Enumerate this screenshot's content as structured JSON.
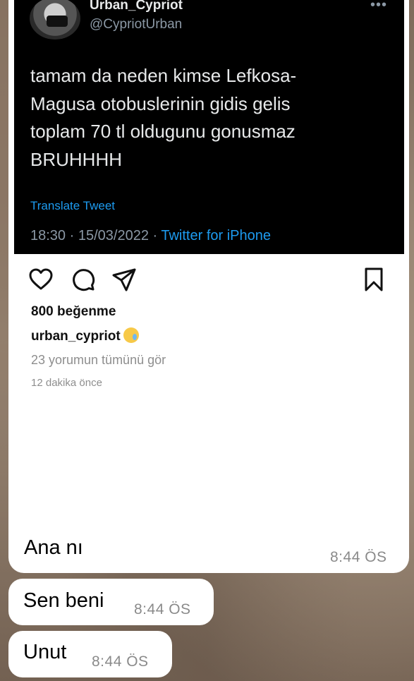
{
  "tweet": {
    "display_name": "Urban_Cypriot",
    "handle": "@CypriotUrban",
    "more_icon": "more-horizontal-icon",
    "text_lines": [
      "tamam da neden kimse Lefkosa-",
      "Magusa otobuslerinin gidis gelis",
      "toplam 70 tl oldugunu gonusmaz",
      "BRUHHHH"
    ],
    "translate_label": "Translate Tweet",
    "time": "18:30",
    "date": "15/03/2022",
    "source": "Twitter for iPhone",
    "accent_color": "#1d9bf0"
  },
  "post": {
    "icons": [
      "heart-icon",
      "comment-icon",
      "share-icon",
      "bookmark-icon"
    ],
    "likes": "800 beğenme",
    "caption_user": "urban_cypriot",
    "caption_emoji": "sad-sweat-emoji",
    "comments_link": "23 yorumun tümünü gör",
    "time_ago": "12 dakika önce"
  },
  "messages": [
    {
      "text": "Ana nı",
      "time": "8:44 ÖS"
    },
    {
      "text": "Sen beni",
      "time": "8:44 ÖS"
    },
    {
      "text": "Unut",
      "time": "8:44 ÖS"
    }
  ]
}
